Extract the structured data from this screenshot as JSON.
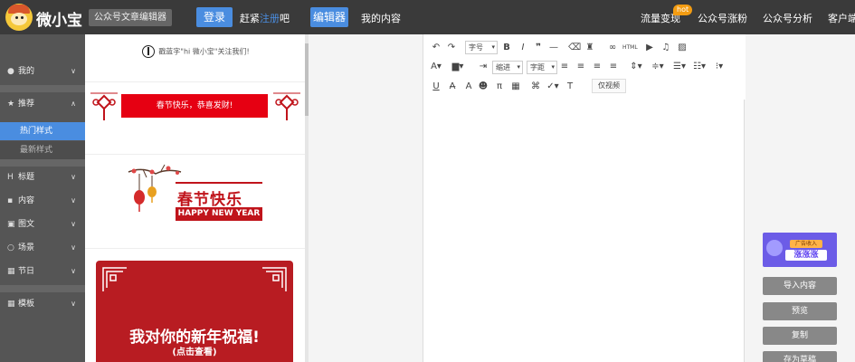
{
  "header": {
    "brand": "微小宝",
    "brand_sub": "公众号文章编辑器",
    "login": "登录",
    "hurry_prefix": "赶紧",
    "register": "注册",
    "hurry_suffix": "吧",
    "editor_btn": "编辑器",
    "my_content": "我的内容",
    "hot_badge": "hot",
    "links": [
      "流量变现",
      "公众号涨粉",
      "公众号分析",
      "客户端"
    ]
  },
  "nav": {
    "items": [
      {
        "icon": "user-icon",
        "label": "我的"
      },
      {
        "icon": "star-icon",
        "label": "推荐"
      },
      {
        "icon": "heading-icon",
        "label": "标题"
      },
      {
        "icon": "document-icon",
        "label": "内容"
      },
      {
        "icon": "image-icon",
        "label": "图文"
      },
      {
        "icon": "chat-icon",
        "label": "场景"
      },
      {
        "icon": "calendar-icon",
        "label": "节日"
      },
      {
        "icon": "grid-icon",
        "label": "模板"
      }
    ],
    "sub": [
      {
        "label": "热门样式",
        "active": true
      },
      {
        "label": "最新样式",
        "active": false
      }
    ]
  },
  "templates": {
    "follow_text": "戳蓝字\"hi 微小宝\"关注我们!",
    "banner1": "春节快乐，恭喜发财!",
    "chun_title": "春节快乐",
    "chun_sub": "HAPPY NEW YEAR",
    "card_wish": "我对你的新年祝福!",
    "card_sub": "(点击查看)"
  },
  "toolbar": {
    "fontsize": "字号",
    "indent": "缩进",
    "spacing": "字距",
    "html": "HTML",
    "view_only": "仅视频"
  },
  "side": {
    "ad_line1": "广告收入",
    "ad_line2": "涨涨涨",
    "buttons": [
      "导入内容",
      "预览",
      "复制",
      "存为草稿"
    ]
  },
  "colors": {
    "topbar": "#3a3a3a",
    "accent": "#4a8de0",
    "festive_red": "#c0141b"
  }
}
